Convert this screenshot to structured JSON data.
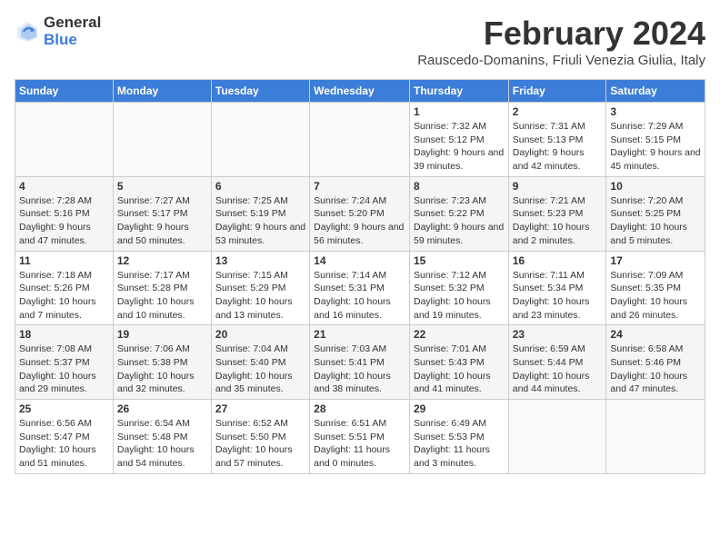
{
  "logo": {
    "line1": "General",
    "line2": "Blue"
  },
  "title": "February 2024",
  "location": "Rauscedo-Domanins, Friuli Venezia Giulia, Italy",
  "days_of_week": [
    "Sunday",
    "Monday",
    "Tuesday",
    "Wednesday",
    "Thursday",
    "Friday",
    "Saturday"
  ],
  "weeks": [
    [
      {
        "day": "",
        "info": ""
      },
      {
        "day": "",
        "info": ""
      },
      {
        "day": "",
        "info": ""
      },
      {
        "day": "",
        "info": ""
      },
      {
        "day": "1",
        "info": "Sunrise: 7:32 AM\nSunset: 5:12 PM\nDaylight: 9 hours and 39 minutes."
      },
      {
        "day": "2",
        "info": "Sunrise: 7:31 AM\nSunset: 5:13 PM\nDaylight: 9 hours and 42 minutes."
      },
      {
        "day": "3",
        "info": "Sunrise: 7:29 AM\nSunset: 5:15 PM\nDaylight: 9 hours and 45 minutes."
      }
    ],
    [
      {
        "day": "4",
        "info": "Sunrise: 7:28 AM\nSunset: 5:16 PM\nDaylight: 9 hours and 47 minutes."
      },
      {
        "day": "5",
        "info": "Sunrise: 7:27 AM\nSunset: 5:17 PM\nDaylight: 9 hours and 50 minutes."
      },
      {
        "day": "6",
        "info": "Sunrise: 7:25 AM\nSunset: 5:19 PM\nDaylight: 9 hours and 53 minutes."
      },
      {
        "day": "7",
        "info": "Sunrise: 7:24 AM\nSunset: 5:20 PM\nDaylight: 9 hours and 56 minutes."
      },
      {
        "day": "8",
        "info": "Sunrise: 7:23 AM\nSunset: 5:22 PM\nDaylight: 9 hours and 59 minutes."
      },
      {
        "day": "9",
        "info": "Sunrise: 7:21 AM\nSunset: 5:23 PM\nDaylight: 10 hours and 2 minutes."
      },
      {
        "day": "10",
        "info": "Sunrise: 7:20 AM\nSunset: 5:25 PM\nDaylight: 10 hours and 5 minutes."
      }
    ],
    [
      {
        "day": "11",
        "info": "Sunrise: 7:18 AM\nSunset: 5:26 PM\nDaylight: 10 hours and 7 minutes."
      },
      {
        "day": "12",
        "info": "Sunrise: 7:17 AM\nSunset: 5:28 PM\nDaylight: 10 hours and 10 minutes."
      },
      {
        "day": "13",
        "info": "Sunrise: 7:15 AM\nSunset: 5:29 PM\nDaylight: 10 hours and 13 minutes."
      },
      {
        "day": "14",
        "info": "Sunrise: 7:14 AM\nSunset: 5:31 PM\nDaylight: 10 hours and 16 minutes."
      },
      {
        "day": "15",
        "info": "Sunrise: 7:12 AM\nSunset: 5:32 PM\nDaylight: 10 hours and 19 minutes."
      },
      {
        "day": "16",
        "info": "Sunrise: 7:11 AM\nSunset: 5:34 PM\nDaylight: 10 hours and 23 minutes."
      },
      {
        "day": "17",
        "info": "Sunrise: 7:09 AM\nSunset: 5:35 PM\nDaylight: 10 hours and 26 minutes."
      }
    ],
    [
      {
        "day": "18",
        "info": "Sunrise: 7:08 AM\nSunset: 5:37 PM\nDaylight: 10 hours and 29 minutes."
      },
      {
        "day": "19",
        "info": "Sunrise: 7:06 AM\nSunset: 5:38 PM\nDaylight: 10 hours and 32 minutes."
      },
      {
        "day": "20",
        "info": "Sunrise: 7:04 AM\nSunset: 5:40 PM\nDaylight: 10 hours and 35 minutes."
      },
      {
        "day": "21",
        "info": "Sunrise: 7:03 AM\nSunset: 5:41 PM\nDaylight: 10 hours and 38 minutes."
      },
      {
        "day": "22",
        "info": "Sunrise: 7:01 AM\nSunset: 5:43 PM\nDaylight: 10 hours and 41 minutes."
      },
      {
        "day": "23",
        "info": "Sunrise: 6:59 AM\nSunset: 5:44 PM\nDaylight: 10 hours and 44 minutes."
      },
      {
        "day": "24",
        "info": "Sunrise: 6:58 AM\nSunset: 5:46 PM\nDaylight: 10 hours and 47 minutes."
      }
    ],
    [
      {
        "day": "25",
        "info": "Sunrise: 6:56 AM\nSunset: 5:47 PM\nDaylight: 10 hours and 51 minutes."
      },
      {
        "day": "26",
        "info": "Sunrise: 6:54 AM\nSunset: 5:48 PM\nDaylight: 10 hours and 54 minutes."
      },
      {
        "day": "27",
        "info": "Sunrise: 6:52 AM\nSunset: 5:50 PM\nDaylight: 10 hours and 57 minutes."
      },
      {
        "day": "28",
        "info": "Sunrise: 6:51 AM\nSunset: 5:51 PM\nDaylight: 11 hours and 0 minutes."
      },
      {
        "day": "29",
        "info": "Sunrise: 6:49 AM\nSunset: 5:53 PM\nDaylight: 11 hours and 3 minutes."
      },
      {
        "day": "",
        "info": ""
      },
      {
        "day": "",
        "info": ""
      }
    ]
  ]
}
